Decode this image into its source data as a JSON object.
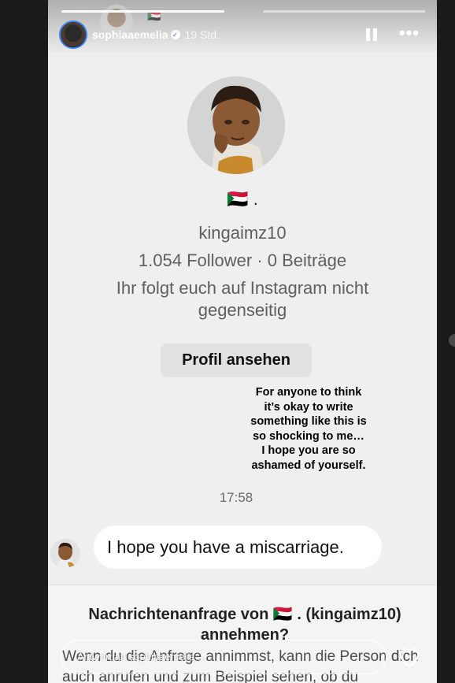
{
  "header": {
    "username": "sophiaaemelia",
    "time_ago": "19 Std."
  },
  "profile": {
    "display_name": "🇸🇩 .",
    "handle": "kingaimz10",
    "stats": "1.054 Follower · 0 Beiträge",
    "mutual_text": "Ihr folgt euch auf Instagram nicht gegenseitig",
    "view_profile_label": "Profil ansehen"
  },
  "story_overlay": {
    "text": "For anyone to think\nit’s okay to write\nsomething like this is\nso shocking to me…\nI hope you are so\nashamed of yourself."
  },
  "chat": {
    "timestamp": "17:58",
    "message": "I hope you have a miscarriage."
  },
  "request": {
    "title": "Nachrichtenanfrage von 🇸🇩 . (kingaimz10) annehmen?",
    "body": "Wenn du die Anfrage annimmst, kann die Person dich auch anrufen und zum Beispiel sehen, ob du"
  },
  "reply": {
    "placeholder": "Antwort an sophiaaemelia ..."
  },
  "progress": {
    "segments": [
      1.0,
      0.0
    ]
  },
  "colors": {
    "background": "#1b1b1b",
    "story_bg": "#efefef",
    "bubble": "#ffffff",
    "verified": "#3b82f6"
  },
  "icons": [
    "verified-badge-icon",
    "pause-icon",
    "more-icon",
    "heart-icon"
  ]
}
